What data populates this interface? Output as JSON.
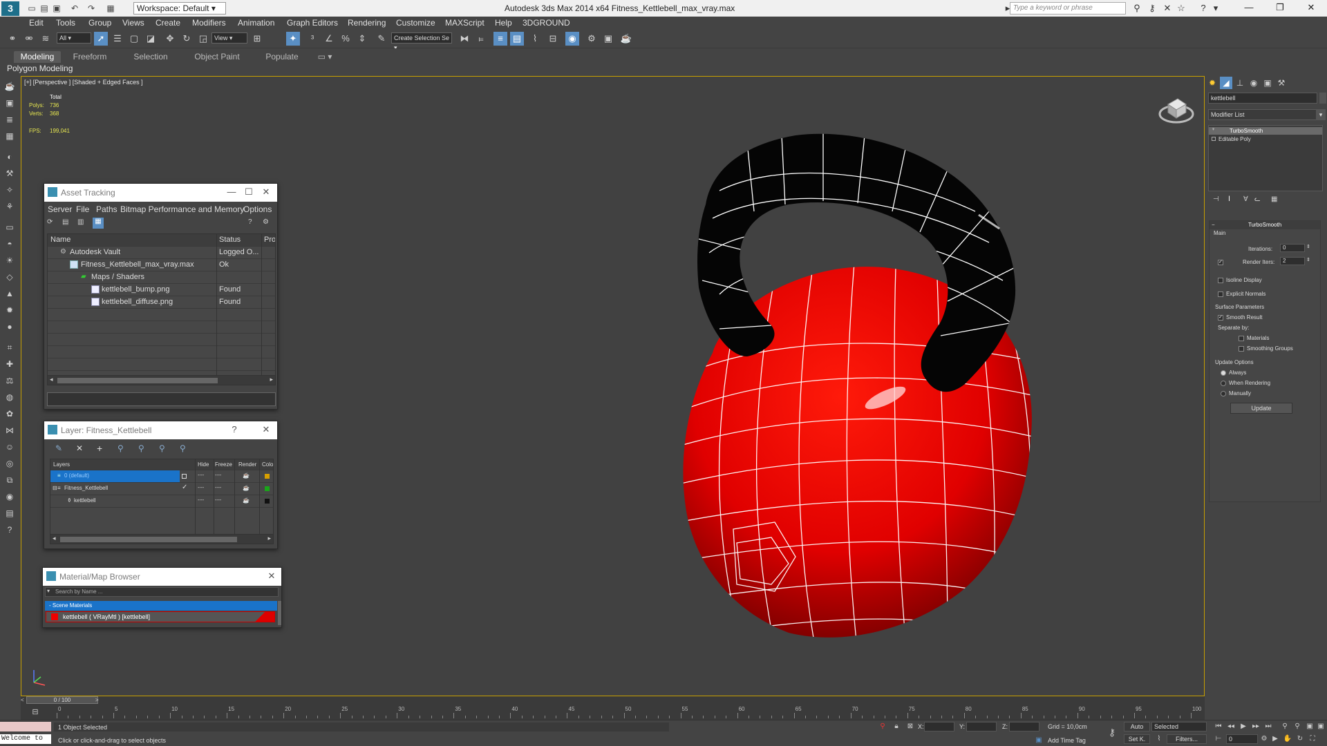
{
  "titlebar": {
    "title": "Autodesk 3ds Max  2014 x64     Fitness_Kettlebell_max_vray.max",
    "workspace": "Workspace: Default",
    "search_placeholder": "Type a keyword or phrase",
    "minimize": "—",
    "restore": "❐",
    "close": "✕"
  },
  "menubar": [
    "Edit",
    "Tools",
    "Group",
    "Views",
    "Create",
    "Modifiers",
    "Animation",
    "Graph Editors",
    "Rendering",
    "Customize",
    "MAXScript",
    "Help",
    "3DGROUND"
  ],
  "toolbar": {
    "filter": "All",
    "refcoord": "View",
    "named_selection": "Create Selection Se"
  },
  "ribbon": {
    "tabs": [
      "Modeling",
      "Freeform",
      "Selection",
      "Object Paint",
      "Populate"
    ],
    "active_tab": "Modeling",
    "subpanel": "Polygon Modeling"
  },
  "viewport": {
    "label": "[+] [Perspective ] [Shaded + Edged Faces ]",
    "stats": {
      "total": "Total",
      "polys_label": "Polys:",
      "polys_value": "736",
      "verts_label": "Verts:",
      "verts_value": "368",
      "fps_label": "FPS:",
      "fps_value": "199,041"
    }
  },
  "asset_tracking": {
    "title": "Asset Tracking",
    "menu": [
      "Server",
      "File",
      "Paths",
      "Bitmap Performance and Memory",
      "Options"
    ],
    "columns": [
      "Name",
      "Status",
      "Prox"
    ],
    "rows": [
      {
        "name": "Autodesk Vault",
        "status": "Logged O..."
      },
      {
        "name": "Fitness_Kettlebell_max_vray.max",
        "status": "Ok"
      },
      {
        "name": "Maps / Shaders",
        "status": ""
      },
      {
        "name": "kettlebell_bump.png",
        "status": "Found"
      },
      {
        "name": "kettlebell_diffuse.png",
        "status": "Found"
      }
    ]
  },
  "layer_window": {
    "title": "Layer: Fitness_Kettlebell",
    "help": "?",
    "columns": [
      "Layers",
      "Hide",
      "Freeze",
      "Render",
      "Colo"
    ],
    "rows": [
      {
        "name": "0 (default)",
        "hide": "----",
        "freeze": "----"
      },
      {
        "name": "Fitness_Kettlebell",
        "hide": "----",
        "freeze": "----"
      },
      {
        "name": "kettlebell",
        "hide": "----",
        "freeze": "----"
      }
    ]
  },
  "material_browser": {
    "title": "Material/Map Browser",
    "search_placeholder": "Search by Name ...",
    "group": "- Scene Materials",
    "item": "kettlebell  ( VRayMtl )  [kettlebell]"
  },
  "command_panel": {
    "object_name": "kettlebell",
    "modifier_list": "Modifier List",
    "stack": [
      "TurboSmooth",
      "Editable Poly"
    ],
    "turbosmooth": {
      "title": "TurboSmooth",
      "main": "Main",
      "iterations_label": "Iterations:",
      "iterations": "0",
      "render_iters_label": "Render Iters:",
      "render_iters": "2",
      "isoline": "Isoline Display",
      "explicit_normals": "Explicit Normals",
      "surface_params": "Surface Parameters",
      "smooth_result": "Smooth Result",
      "separate_by": "Separate by:",
      "materials": "Materials",
      "smoothing_groups": "Smoothing Groups",
      "update_options": "Update Options",
      "always": "Always",
      "when_rendering": "When Rendering",
      "manually": "Manually",
      "update_button": "Update"
    }
  },
  "timeline": {
    "frame": "0 / 100",
    "ticks": [
      "0",
      "5",
      "10",
      "15",
      "20",
      "25",
      "30",
      "35",
      "40",
      "45",
      "50",
      "55",
      "60",
      "65",
      "70",
      "75",
      "80",
      "85",
      "90",
      "95",
      "100"
    ]
  },
  "statusbar": {
    "maxscript": "Welcome to",
    "selected": "1 Object Selected",
    "prompt": "Click or click-and-drag to select objects",
    "x_label": "X:",
    "y_label": "Y:",
    "z_label": "Z:",
    "grid": "Grid = 10,0cm",
    "add_time_tag": "Add Time Tag",
    "auto": "Auto",
    "setk": "Set K.",
    "selected_drop": "Selected",
    "filters": "Filters...",
    "frame_field": "0"
  },
  "colors": {
    "kettlebell_body": "#e00000",
    "kettlebell_handle": "#050505",
    "viewport_border": "#c8a000",
    "accent": "#5a8fc4"
  }
}
